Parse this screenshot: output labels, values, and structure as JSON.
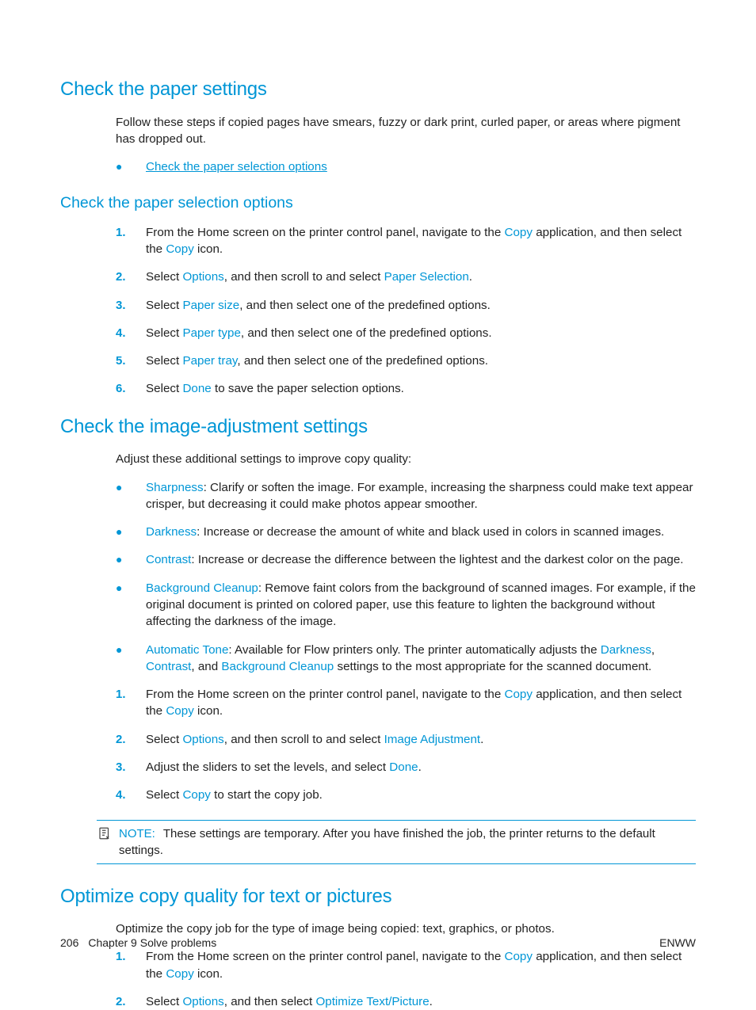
{
  "section1": {
    "title": "Check the paper settings",
    "intro": "Follow these steps if copied pages have smears, fuzzy or dark print, curled paper, or areas where pigment has dropped out.",
    "toc_link": "Check the paper selection options",
    "sub_title": "Check the paper selection options",
    "step1_a": "From the Home screen on the printer control panel, navigate to the ",
    "step1_b": "Copy",
    "step1_c": " application, and then select the ",
    "step1_d": "Copy",
    "step1_e": " icon.",
    "step2_a": "Select ",
    "step2_b": "Options",
    "step2_c": ", and then scroll to and select ",
    "step2_d": "Paper Selection",
    "step2_e": ".",
    "step3_a": "Select ",
    "step3_b": "Paper size",
    "step3_c": ", and then select one of the predefined options.",
    "step4_a": "Select ",
    "step4_b": "Paper type",
    "step4_c": ", and then select one of the predefined options.",
    "step5_a": "Select ",
    "step5_b": "Paper tray",
    "step5_c": ", and then select one of the predefined options.",
    "step6_a": "Select ",
    "step6_b": "Done",
    "step6_c": " to save the paper selection options."
  },
  "section2": {
    "title": "Check the image-adjustment settings",
    "intro": "Adjust these additional settings to improve copy quality:",
    "b1_t": "Sharpness",
    "b1_r": ": Clarify or soften the image. For example, increasing the sharpness could make text appear crisper, but decreasing it could make photos appear smoother.",
    "b2_t": "Darkness",
    "b2_r": ": Increase or decrease the amount of white and black used in colors in scanned images.",
    "b3_t": "Contrast",
    "b3_r": ": Increase or decrease the difference between the lightest and the darkest color on the page.",
    "b4_t": "Background Cleanup",
    "b4_r": ": Remove faint colors from the background of scanned images. For example, if the original document is printed on colored paper, use this feature to lighten the background without affecting the darkness of the image.",
    "b5_t": "Automatic Tone",
    "b5_a": ": Available for Flow printers only. The printer automatically adjusts the ",
    "b5_b": "Darkness",
    "b5_c": ", ",
    "b5_d": "Contrast",
    "b5_e": ", and ",
    "b5_f": "Background Cleanup",
    "b5_g": " settings to the most appropriate for the scanned document.",
    "step1_a": "From the Home screen on the printer control panel, navigate to the ",
    "step1_b": "Copy",
    "step1_c": " application, and then select the ",
    "step1_d": "Copy",
    "step1_e": " icon.",
    "step2_a": "Select ",
    "step2_b": "Options",
    "step2_c": ", and then scroll to and select ",
    "step2_d": "Image Adjustment",
    "step2_e": ".",
    "step3_a": "Adjust the sliders to set the levels, and select ",
    "step3_b": "Done",
    "step3_c": ".",
    "step4_a": "Select ",
    "step4_b": "Copy",
    "step4_c": " to start the copy job.",
    "note_label": "NOTE:",
    "note_text": "These settings are temporary. After you have finished the job, the printer returns to the default settings."
  },
  "section3": {
    "title": "Optimize copy quality for text or pictures",
    "intro": "Optimize the copy job for the type of image being copied: text, graphics, or photos.",
    "step1_a": "From the Home screen on the printer control panel, navigate to the ",
    "step1_b": "Copy",
    "step1_c": " application, and then select the ",
    "step1_d": "Copy",
    "step1_e": " icon.",
    "step2_a": "Select ",
    "step2_b": "Options",
    "step2_c": ", and then select ",
    "step2_d": "Optimize Text/Picture",
    "step2_e": "."
  },
  "nums": {
    "n1": "1.",
    "n2": "2.",
    "n3": "3.",
    "n4": "4.",
    "n5": "5.",
    "n6": "6."
  },
  "bullet": "●",
  "footer": {
    "page_no": "206",
    "chapter": "Chapter 9   Solve problems",
    "right": "ENWW"
  }
}
